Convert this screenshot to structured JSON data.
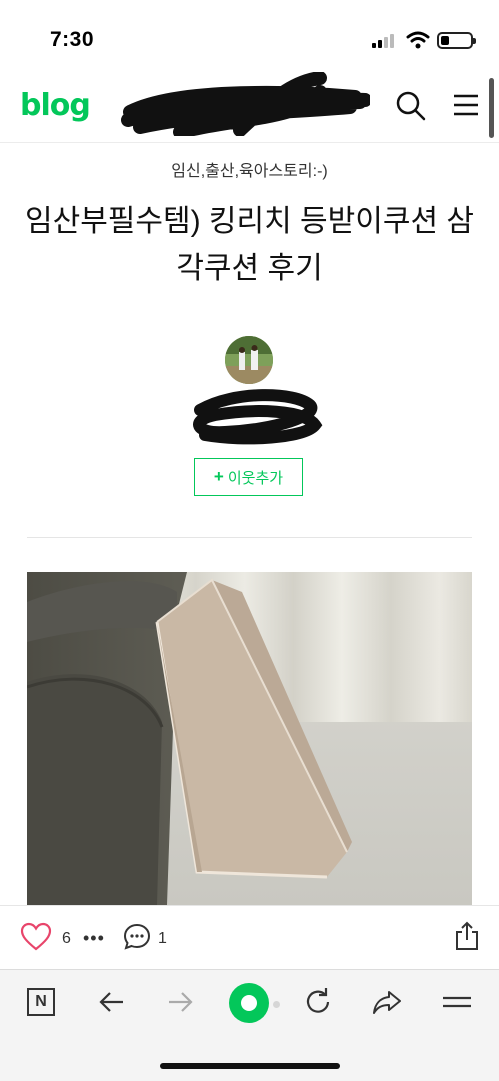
{
  "status_bar": {
    "time": "7:30",
    "battery_level": 0.25
  },
  "header": {
    "logo": "blog",
    "search_icon": "search-icon",
    "menu_icon": "hamburger-menu-icon"
  },
  "post": {
    "category": "임신,출산,육아스토리:-)",
    "title": "임산부필수템) 킹리치 등받이쿠션 삼각쿠션 후기",
    "add_neighbor_label": "이웃추가"
  },
  "actions": {
    "like_count": "6",
    "more": "•••",
    "comment_count": "1"
  },
  "colors": {
    "brand_green": "#03c75a",
    "heart_pink": "#e8456b"
  }
}
